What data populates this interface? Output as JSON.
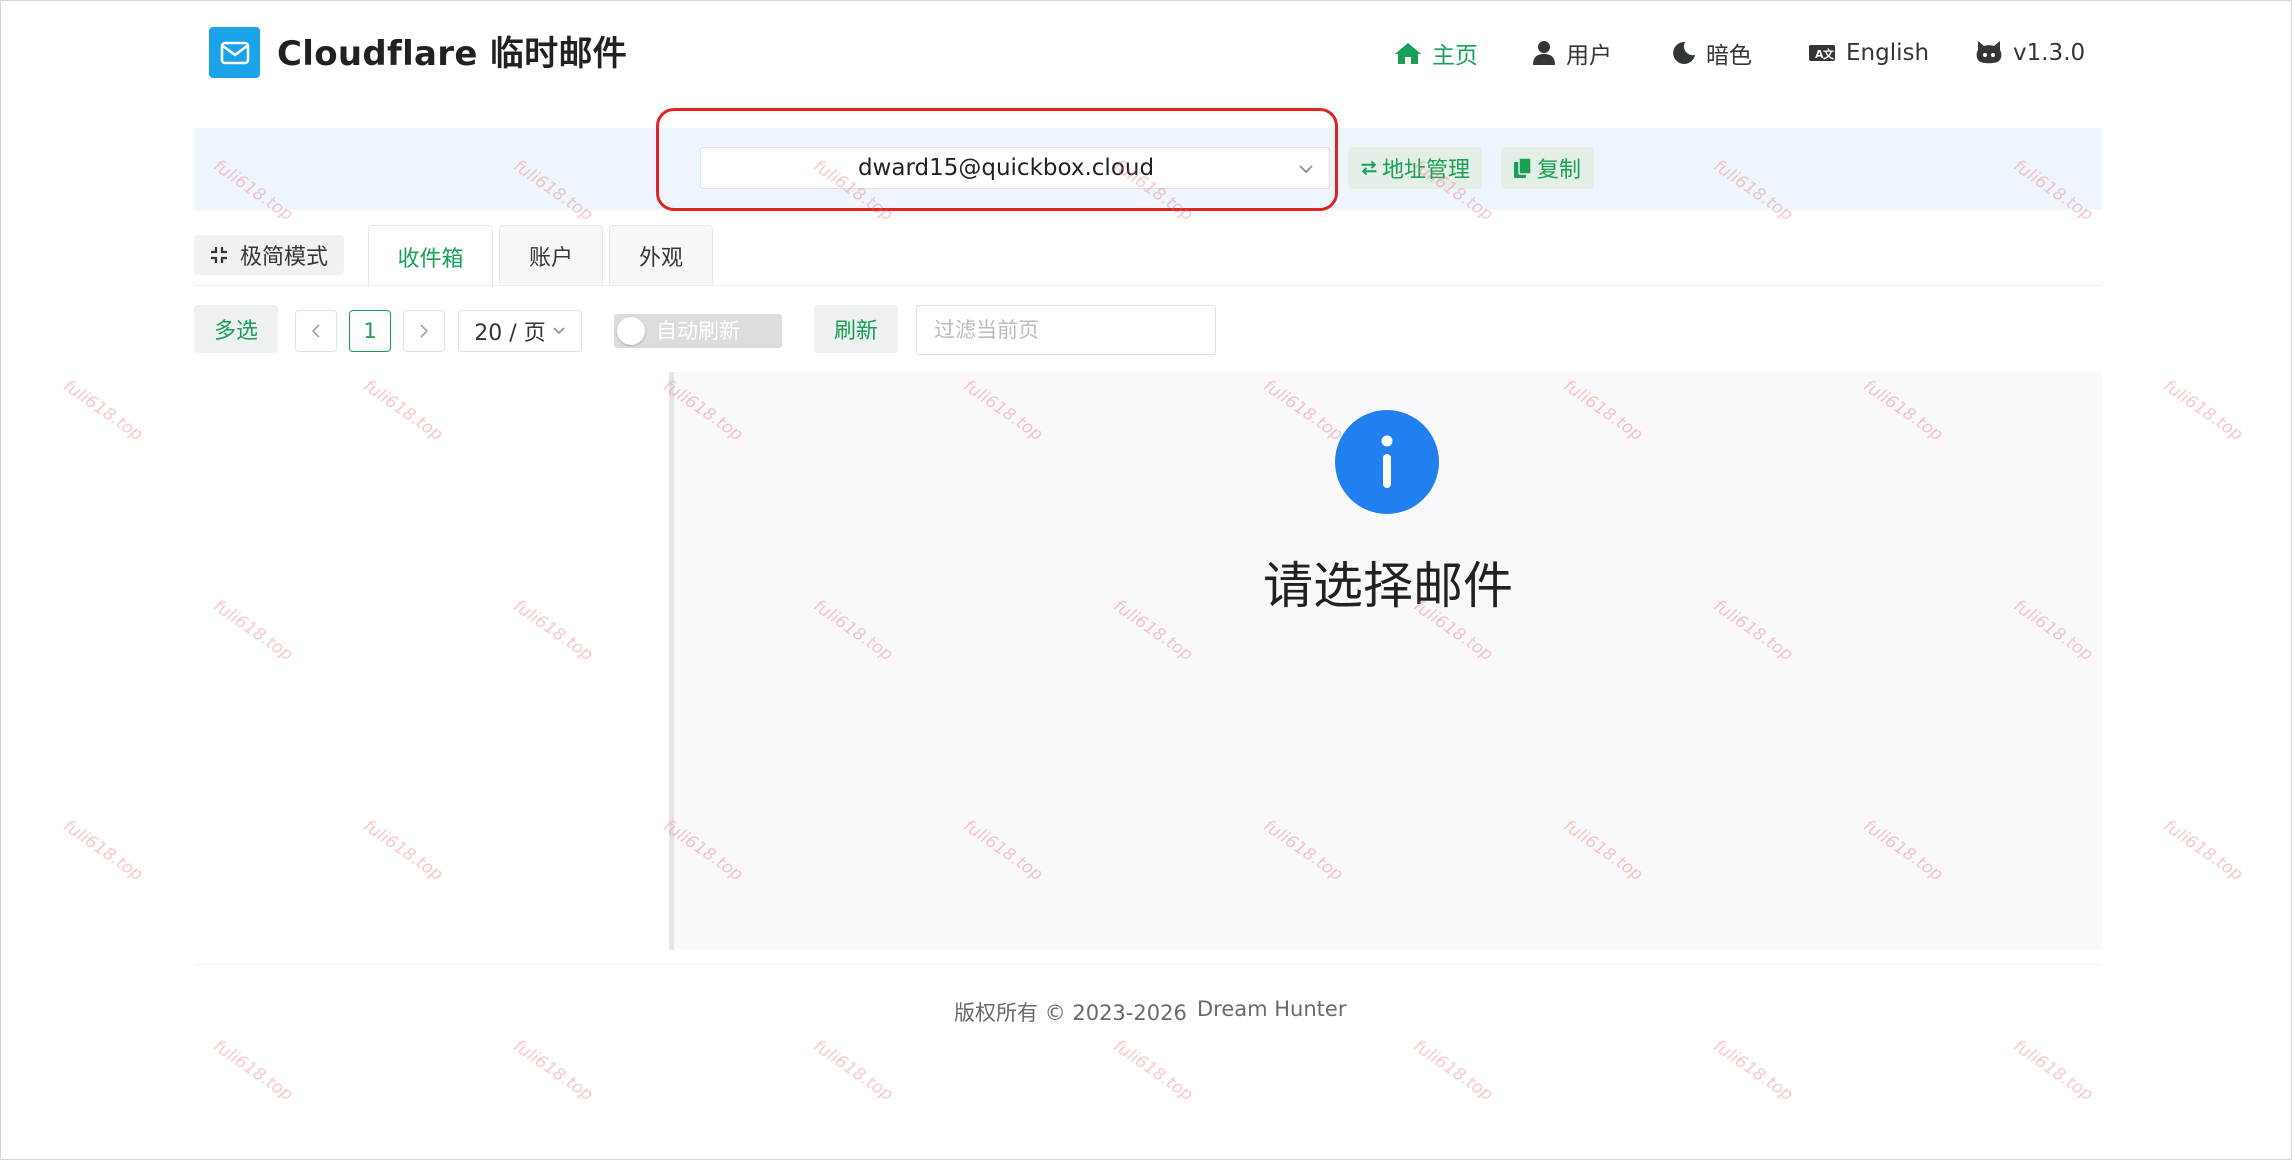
{
  "header": {
    "title": "Cloudflare 临时邮件",
    "nav": [
      {
        "label": "主页",
        "icon": "home-icon",
        "active": true
      },
      {
        "label": "用户",
        "icon": "user-icon",
        "active": false
      },
      {
        "label": "暗色",
        "icon": "moon-icon",
        "active": false
      },
      {
        "label": "English",
        "icon": "language-icon",
        "active": false
      },
      {
        "label": "v1.3.0",
        "icon": "github-icon",
        "active": false
      }
    ]
  },
  "address_bar": {
    "selected_address": "dward15@quickbox.cloud",
    "manage_label": "地址管理",
    "copy_label": "复制"
  },
  "tabs": {
    "mode_label": "极简模式",
    "items": [
      {
        "label": "收件箱",
        "active": true
      },
      {
        "label": "账户",
        "active": false
      },
      {
        "label": "外观",
        "active": false
      }
    ]
  },
  "toolbar": {
    "multi_select_label": "多选",
    "current_page": "1",
    "page_size": "20 / 页",
    "auto_refresh_label": "自动刷新",
    "auto_refresh_on": false,
    "refresh_label": "刷新",
    "filter_placeholder": "过滤当前页"
  },
  "detail": {
    "empty_text": "请选择邮件"
  },
  "footer": {
    "copyright": "版权所有 © 2023-2026",
    "author": "Dream Hunter"
  },
  "watermark": {
    "text": "fuli618.top"
  },
  "colors": {
    "accent": "#18a058",
    "info": "#2080f0",
    "logo": "#1aa3e8",
    "highlight_border": "#e02424"
  }
}
